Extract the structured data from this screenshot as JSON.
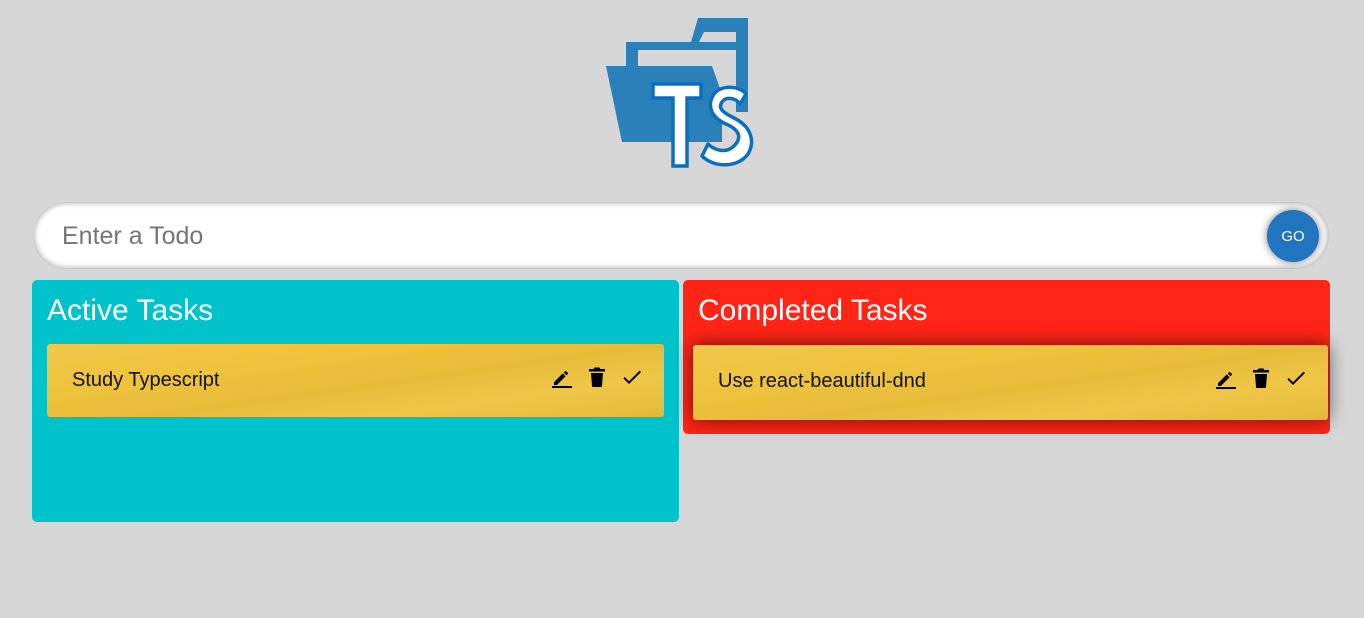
{
  "colors": {
    "background": "#d6d6d6",
    "logo_blue": "#2a80b9",
    "go_button": "#2175be",
    "active_panel": "#00c2cb",
    "completed_panel": "#ff2516",
    "task_card": "#eec33c"
  },
  "logo": {
    "text": "TS",
    "icon": "folder-ts-icon"
  },
  "input": {
    "placeholder": "Enter a Todo",
    "value": "",
    "submit_label": "GO"
  },
  "active": {
    "title": "Active Tasks",
    "tasks": [
      {
        "text": "Study Typescript",
        "icons": [
          "edit-icon",
          "delete-icon",
          "check-icon"
        ]
      }
    ]
  },
  "completed": {
    "title": "Completed Tasks",
    "tasks": [
      {
        "text": "Use react-beautiful-dnd",
        "icons": [
          "edit-icon",
          "delete-icon",
          "check-icon"
        ]
      }
    ]
  }
}
